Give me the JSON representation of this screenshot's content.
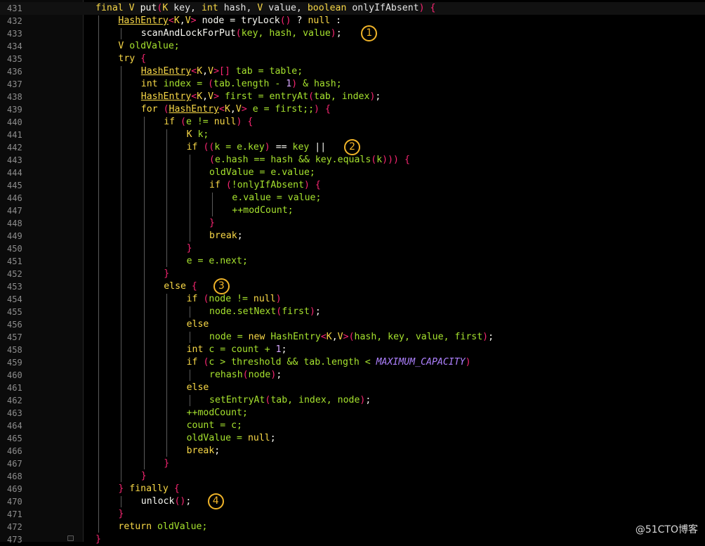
{
  "editor": {
    "colors": {
      "background": "#000000",
      "gutter": "#0b0b0b",
      "line_number": "#8d8d8d",
      "keyword": "#f8d847",
      "generic": "#f92672",
      "field": "#a6e22e",
      "constant": "#ae81ff",
      "annotation": "#f0b429"
    },
    "current_line": 431,
    "lines": [
      {
        "n": "431",
        "indent": 1,
        "tokens": [
          [
            "final",
            "kw"
          ],
          [
            " ",
            "op"
          ],
          [
            "V",
            "kw"
          ],
          [
            " ",
            "op"
          ],
          [
            "put",
            "fn"
          ],
          [
            "(",
            "paren"
          ],
          [
            "K",
            "kw"
          ],
          [
            " key, ",
            "param"
          ],
          [
            "int",
            "kw"
          ],
          [
            " hash, ",
            "param"
          ],
          [
            "V",
            "kw"
          ],
          [
            " value, ",
            "param"
          ],
          [
            "boolean",
            "kw"
          ],
          [
            " onlyIfAbsent",
            "param"
          ],
          [
            ")",
            "paren"
          ],
          [
            " {",
            "paren"
          ]
        ]
      },
      {
        "n": "432",
        "indent": 2,
        "tokens": [
          [
            "HashEntry",
            "type"
          ],
          [
            "<",
            "gen"
          ],
          [
            "K",
            "kw"
          ],
          [
            ",",
            "op"
          ],
          [
            "V",
            "kw"
          ],
          [
            ">",
            "gen"
          ],
          [
            " node = tryLock",
            "id"
          ],
          [
            "()",
            "paren"
          ],
          [
            " ? ",
            "op"
          ],
          [
            "null",
            "kw"
          ],
          [
            " :",
            "op"
          ]
        ]
      },
      {
        "n": "433",
        "indent": 3,
        "tokens": [
          [
            "scanAndLockForPut",
            "call"
          ],
          [
            "(",
            "paren"
          ],
          [
            "key, hash, value",
            "field"
          ],
          [
            ")",
            "paren"
          ],
          [
            ";",
            "punc"
          ]
        ]
      },
      {
        "n": "434",
        "indent": 2,
        "tokens": [
          [
            "V",
            "kw"
          ],
          [
            " oldValue;",
            "field"
          ]
        ]
      },
      {
        "n": "435",
        "indent": 2,
        "tokens": [
          [
            "try",
            "kw"
          ],
          [
            " {",
            "paren"
          ]
        ]
      },
      {
        "n": "436",
        "indent": 3,
        "tokens": [
          [
            "HashEntry",
            "type"
          ],
          [
            "<",
            "gen"
          ],
          [
            "K",
            "kw"
          ],
          [
            ",",
            "op"
          ],
          [
            "V",
            "kw"
          ],
          [
            ">",
            "gen"
          ],
          [
            "[]",
            "paren"
          ],
          [
            " tab = table;",
            "field"
          ]
        ]
      },
      {
        "n": "437",
        "indent": 3,
        "tokens": [
          [
            "int",
            "kw"
          ],
          [
            " index = ",
            "field"
          ],
          [
            "(",
            "paren"
          ],
          [
            "tab.length - ",
            "field"
          ],
          [
            "1",
            "num"
          ],
          [
            ")",
            "paren"
          ],
          [
            " & hash;",
            "field"
          ]
        ]
      },
      {
        "n": "438",
        "indent": 3,
        "tokens": [
          [
            "HashEntry",
            "type"
          ],
          [
            "<",
            "gen"
          ],
          [
            "K",
            "kw"
          ],
          [
            ",",
            "op"
          ],
          [
            "V",
            "kw"
          ],
          [
            ">",
            "gen"
          ],
          [
            " first = entryAt",
            "field"
          ],
          [
            "(",
            "paren"
          ],
          [
            "tab, index",
            "field"
          ],
          [
            ")",
            "paren"
          ],
          [
            ";",
            "punc"
          ]
        ]
      },
      {
        "n": "439",
        "indent": 3,
        "tokens": [
          [
            "for",
            "kw"
          ],
          [
            " ",
            "op"
          ],
          [
            "(",
            "paren"
          ],
          [
            "HashEntry",
            "type"
          ],
          [
            "<",
            "gen"
          ],
          [
            "K",
            "kw"
          ],
          [
            ",",
            "op"
          ],
          [
            "V",
            "kw"
          ],
          [
            ">",
            "gen"
          ],
          [
            " e = first;;",
            "field"
          ],
          [
            ")",
            "paren"
          ],
          [
            " {",
            "paren"
          ]
        ]
      },
      {
        "n": "440",
        "indent": 4,
        "tokens": [
          [
            "if",
            "kw"
          ],
          [
            " ",
            "op"
          ],
          [
            "(",
            "paren"
          ],
          [
            "e != ",
            "field"
          ],
          [
            "null",
            "kw"
          ],
          [
            ")",
            "paren"
          ],
          [
            " {",
            "paren"
          ]
        ]
      },
      {
        "n": "441",
        "indent": 5,
        "tokens": [
          [
            "K",
            "kw"
          ],
          [
            " k;",
            "field"
          ]
        ]
      },
      {
        "n": "442",
        "indent": 5,
        "tokens": [
          [
            "if",
            "kw"
          ],
          [
            " ",
            "op"
          ],
          [
            "((",
            "paren"
          ],
          [
            "k = e.key",
            "field"
          ],
          [
            ")",
            "paren"
          ],
          [
            " == ",
            "op"
          ],
          [
            "key",
            "field"
          ],
          [
            " ||",
            "op"
          ]
        ]
      },
      {
        "n": "443",
        "indent": 6,
        "tokens": [
          [
            "(",
            "paren"
          ],
          [
            "e.hash == hash && key.equals",
            "field"
          ],
          [
            "(",
            "paren"
          ],
          [
            "k",
            "field"
          ],
          [
            ")))",
            "paren"
          ],
          [
            " {",
            "paren"
          ]
        ]
      },
      {
        "n": "444",
        "indent": 6,
        "tokens": [
          [
            "oldValue = e.value;",
            "field"
          ]
        ]
      },
      {
        "n": "445",
        "indent": 6,
        "tokens": [
          [
            "if",
            "kw"
          ],
          [
            " ",
            "op"
          ],
          [
            "(",
            "paren"
          ],
          [
            "!onlyIfAbsent",
            "field"
          ],
          [
            ")",
            "paren"
          ],
          [
            " {",
            "paren"
          ]
        ]
      },
      {
        "n": "446",
        "indent": 7,
        "tokens": [
          [
            "e.value = value;",
            "field"
          ]
        ]
      },
      {
        "n": "447",
        "indent": 7,
        "tokens": [
          [
            "++modCount;",
            "field"
          ]
        ]
      },
      {
        "n": "448",
        "indent": 6,
        "tokens": [
          [
            "}",
            "paren"
          ]
        ]
      },
      {
        "n": "449",
        "indent": 6,
        "tokens": [
          [
            "break",
            "kw"
          ],
          [
            ";",
            "punc"
          ]
        ]
      },
      {
        "n": "450",
        "indent": 5,
        "tokens": [
          [
            "}",
            "paren"
          ]
        ]
      },
      {
        "n": "451",
        "indent": 5,
        "tokens": [
          [
            "e = e.next;",
            "field"
          ]
        ]
      },
      {
        "n": "452",
        "indent": 4,
        "tokens": [
          [
            "}",
            "paren"
          ]
        ]
      },
      {
        "n": "453",
        "indent": 4,
        "tokens": [
          [
            "else",
            "kw"
          ],
          [
            " {",
            "paren"
          ]
        ]
      },
      {
        "n": "454",
        "indent": 5,
        "tokens": [
          [
            "if",
            "kw"
          ],
          [
            " ",
            "op"
          ],
          [
            "(",
            "paren"
          ],
          [
            "node != ",
            "field"
          ],
          [
            "null",
            "kw"
          ],
          [
            ")",
            "paren"
          ]
        ]
      },
      {
        "n": "455",
        "indent": 6,
        "tokens": [
          [
            "node.setNext",
            "field"
          ],
          [
            "(",
            "paren"
          ],
          [
            "first",
            "field"
          ],
          [
            ")",
            "paren"
          ],
          [
            ";",
            "punc"
          ]
        ]
      },
      {
        "n": "456",
        "indent": 5,
        "tokens": [
          [
            "else",
            "kw"
          ]
        ]
      },
      {
        "n": "457",
        "indent": 6,
        "tokens": [
          [
            "node = ",
            "field"
          ],
          [
            "new",
            "kw"
          ],
          [
            " HashEntry",
            "field"
          ],
          [
            "<",
            "gen"
          ],
          [
            "K",
            "kw"
          ],
          [
            ",",
            "op"
          ],
          [
            "V",
            "kw"
          ],
          [
            ">",
            "gen"
          ],
          [
            "(",
            "paren"
          ],
          [
            "hash, key, value, first",
            "field"
          ],
          [
            ")",
            "paren"
          ],
          [
            ";",
            "punc"
          ]
        ]
      },
      {
        "n": "458",
        "indent": 5,
        "tokens": [
          [
            "int",
            "kw"
          ],
          [
            " c = count + ",
            "field"
          ],
          [
            "1",
            "num"
          ],
          [
            ";",
            "punc"
          ]
        ]
      },
      {
        "n": "459",
        "indent": 5,
        "tokens": [
          [
            "if",
            "kw"
          ],
          [
            " ",
            "op"
          ],
          [
            "(",
            "paren"
          ],
          [
            "c > threshold && tab.length < ",
            "field"
          ],
          [
            "MAXIMUM_CAPACITY",
            "const"
          ],
          [
            ")",
            "paren"
          ]
        ]
      },
      {
        "n": "460",
        "indent": 6,
        "tokens": [
          [
            "rehash",
            "field"
          ],
          [
            "(",
            "paren"
          ],
          [
            "node",
            "field"
          ],
          [
            ")",
            "paren"
          ],
          [
            ";",
            "punc"
          ]
        ]
      },
      {
        "n": "461",
        "indent": 5,
        "tokens": [
          [
            "else",
            "kw"
          ]
        ]
      },
      {
        "n": "462",
        "indent": 6,
        "tokens": [
          [
            "setEntryAt",
            "field"
          ],
          [
            "(",
            "paren"
          ],
          [
            "tab, index, node",
            "field"
          ],
          [
            ")",
            "paren"
          ],
          [
            ";",
            "punc"
          ]
        ]
      },
      {
        "n": "463",
        "indent": 5,
        "tokens": [
          [
            "++modCount;",
            "field"
          ]
        ]
      },
      {
        "n": "464",
        "indent": 5,
        "tokens": [
          [
            "count = c;",
            "field"
          ]
        ]
      },
      {
        "n": "465",
        "indent": 5,
        "tokens": [
          [
            "oldValue = ",
            "field"
          ],
          [
            "null",
            "kw"
          ],
          [
            ";",
            "punc"
          ]
        ]
      },
      {
        "n": "466",
        "indent": 5,
        "tokens": [
          [
            "break",
            "kw"
          ],
          [
            ";",
            "punc"
          ]
        ]
      },
      {
        "n": "467",
        "indent": 4,
        "tokens": [
          [
            "}",
            "paren"
          ]
        ]
      },
      {
        "n": "468",
        "indent": 3,
        "tokens": [
          [
            "}",
            "paren"
          ]
        ]
      },
      {
        "n": "469",
        "indent": 2,
        "tokens": [
          [
            "}",
            "paren"
          ],
          [
            " ",
            "op"
          ],
          [
            "finally",
            "kw"
          ],
          [
            " {",
            "paren"
          ]
        ]
      },
      {
        "n": "470",
        "indent": 3,
        "tokens": [
          [
            "unlock",
            "call"
          ],
          [
            "()",
            "paren"
          ],
          [
            ";",
            "punc"
          ]
        ]
      },
      {
        "n": "471",
        "indent": 2,
        "tokens": [
          [
            "}",
            "paren"
          ]
        ]
      },
      {
        "n": "472",
        "indent": 2,
        "tokens": [
          [
            "return",
            "kw"
          ],
          [
            " oldValue;",
            "field"
          ]
        ]
      },
      {
        "n": "473",
        "indent": 1,
        "tokens": [
          [
            "}",
            "paren"
          ]
        ]
      }
    ]
  },
  "annotations": [
    {
      "label": "1",
      "line": "433"
    },
    {
      "label": "2",
      "line": "442"
    },
    {
      "label": "3",
      "line": "453"
    },
    {
      "label": "4",
      "line": "470"
    }
  ],
  "watermark": "@51CTO博客"
}
